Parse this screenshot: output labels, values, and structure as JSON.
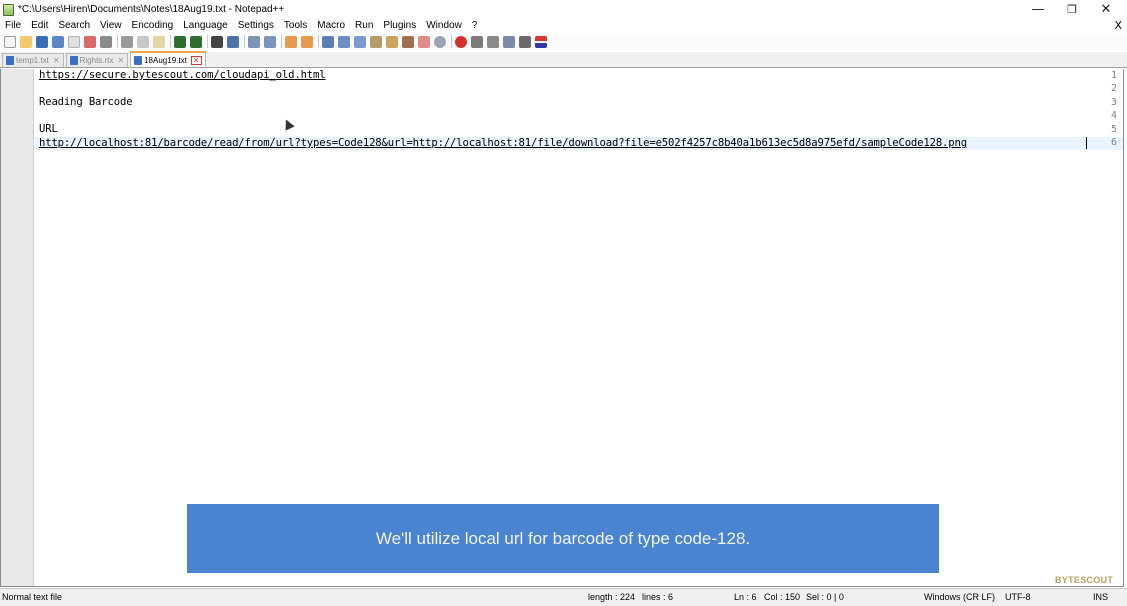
{
  "window": {
    "title": "*C:\\Users\\Hiren\\Documents\\Notes\\18Aug19.txt - Notepad++",
    "minimize": "—",
    "restore": "❐",
    "close": "✕",
    "close_document": "X"
  },
  "menu": [
    "File",
    "Edit",
    "Search",
    "View",
    "Encoding",
    "Language",
    "Settings",
    "Tools",
    "Macro",
    "Run",
    "Plugins",
    "Window",
    "?"
  ],
  "toolbar_icons": [
    "new-file-icon",
    "open-file-icon",
    "save-icon",
    "save-all-icon",
    "close-icon",
    "close-all-icon",
    "print-icon",
    "cut-icon",
    "copy-icon",
    "paste-icon",
    "undo-icon",
    "redo-icon",
    "find-icon",
    "replace-icon",
    "zoom-in-icon",
    "zoom-out-icon",
    "sync-vertical-icon",
    "sync-horizontal-icon",
    "word-wrap-icon",
    "show-all-chars-icon",
    "indent-guide-icon",
    "udl-icon",
    "doc-map-icon",
    "function-list-icon",
    "folder-workspace-icon",
    "monitoring-icon",
    "record-macro-icon",
    "stop-record-icon",
    "play-macro-icon",
    "run-multiple-icon",
    "save-macro-icon",
    "spellcheck-icon"
  ],
  "tabs": [
    {
      "label": "temp1.txt",
      "active": false
    },
    {
      "label": "Rights.rtx",
      "active": false
    },
    {
      "label": "18Aug19.txt",
      "active": true
    }
  ],
  "editor": {
    "lines": [
      {
        "num": "1",
        "text": "https://secure.bytescout.com/cloudapi_old.html",
        "link": true
      },
      {
        "num": "2",
        "text": "",
        "link": false
      },
      {
        "num": "3",
        "text": "Reading Barcode",
        "link": false
      },
      {
        "num": "4",
        "text": "",
        "link": false
      },
      {
        "num": "5",
        "text": "URL",
        "link": false
      },
      {
        "num": "6",
        "text": "http://localhost:81/barcode/read/from/url?types=Code128&url=http://localhost:81/file/download?file=e502f4257c8b40a1b613ec5d8a975efd/sampleCode128.png",
        "link": true
      }
    ]
  },
  "caption": "We'll utilize local url for barcode of type code-128.",
  "watermark": "BYTESCOUT",
  "status": {
    "file_type": "Normal text file",
    "length": "length : 224",
    "lines": "lines : 6",
    "ln": "Ln : 6",
    "col": "Col : 150",
    "sel": "Sel : 0 | 0",
    "eol": "Windows (CR LF)",
    "encoding": "UTF-8",
    "mode": "INS"
  }
}
